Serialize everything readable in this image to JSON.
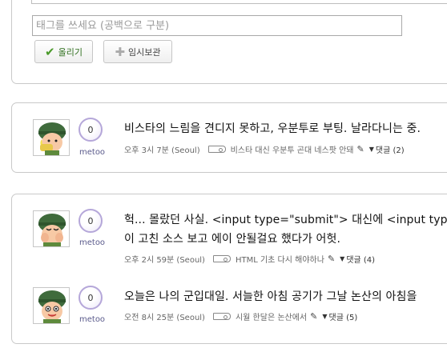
{
  "composer": {
    "tag_placeholder": "태그를 쓰세요 (공백으로 구분)",
    "post_button": "올리기",
    "draft_button": "임시보관"
  },
  "entries": [
    {
      "counter": "0",
      "metoo": "metoo",
      "text_line1": "비스타의 느림을 견디지 못하고, 우분투로 부팅. 날라다니는 중.",
      "time": "오후 3시 7분 (Seoul)",
      "tags": "비스타 대신 우분투 곤대 네스팟 안돼",
      "comments": "댓글 (2)"
    },
    {
      "counter": "0",
      "metoo": "metoo",
      "text_line1": "헉... 몰랐던 사실. <input type=\"submit\"> 대신에 <input type",
      "text_line2": "이 고친 소스 보고 에이 안될걸요 했다가 어헛.",
      "time": "오후 2시 59분 (Seoul)",
      "tags": "HTML 기초 다시 해야하나",
      "comments": "댓글 (4)"
    },
    {
      "counter": "0",
      "metoo": "metoo",
      "text_line1": "오늘은 나의 군입대일. 서늘한 아침 공기가 그날 논산의 아침을",
      "time": "오전 8시 25분 (Seoul)",
      "tags": "시월 한달은 논산에서",
      "comments": "댓글 (5)"
    }
  ],
  "icons": {
    "post": "check-icon",
    "draft": "plus-icon",
    "tag": "tag-icon",
    "edit": "pencil-icon",
    "comments": "caret-down-icon"
  },
  "colors": {
    "counter_border": "#b5a7d9",
    "metoo_text": "#5b5b8c",
    "post_check": "#4a9a2a"
  }
}
